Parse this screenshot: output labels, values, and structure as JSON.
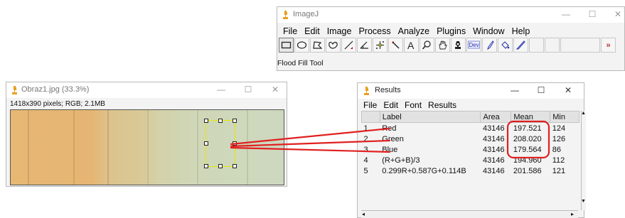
{
  "imagej": {
    "title": "ImageJ",
    "window_controls": [
      "—",
      "☐",
      "✕"
    ],
    "menu": [
      "File",
      "Edit",
      "Image",
      "Process",
      "Analyze",
      "Plugins",
      "Window",
      "Help"
    ],
    "tools": [
      "rectangle-selection",
      "oval-selection",
      "polygon-selection",
      "freehand-selection",
      "straight-line",
      "angle",
      "multi-point",
      "wand",
      "text",
      "magnifying-glass",
      "scrolling",
      "color-picker",
      "dev-menu",
      "brush",
      "flood-filler",
      "pencil",
      "blank",
      "blank",
      "more-tools"
    ],
    "dev_label": "Dev",
    "more_label": "»",
    "status": "Flood Fill Tool"
  },
  "image_window": {
    "title": "Obraz1.jpg (33.3%)",
    "info": "1418x390 pixels; RGB; 2.1MB",
    "window_controls": [
      "—",
      "☐",
      "✕"
    ]
  },
  "results": {
    "title": "Results",
    "window_controls": [
      "—",
      "☐",
      "✕"
    ],
    "menu": [
      "File",
      "Edit",
      "Font",
      "Results"
    ],
    "columns": [
      "",
      "Label",
      "Area",
      "Mean",
      "Min"
    ],
    "rows": [
      {
        "n": "1",
        "label": "Red",
        "area": "43146",
        "mean": "197.521",
        "min": "124"
      },
      {
        "n": "2",
        "label": "Green",
        "area": "43146",
        "mean": "208.020",
        "min": "126"
      },
      {
        "n": "3",
        "label": "Blue",
        "area": "43146",
        "mean": "179.564",
        "min": "86"
      },
      {
        "n": "4",
        "label": "(R+G+B)/3",
        "area": "43146",
        "mean": "194.960",
        "min": "112"
      },
      {
        "n": "5",
        "label": "0.299R+0.587G+0.114B",
        "area": "43146",
        "mean": "201.586",
        "min": "121"
      }
    ]
  },
  "colors": {
    "annotation": "#e02020",
    "selection": "#e8e800",
    "imagej_icon": "#e8a020"
  }
}
